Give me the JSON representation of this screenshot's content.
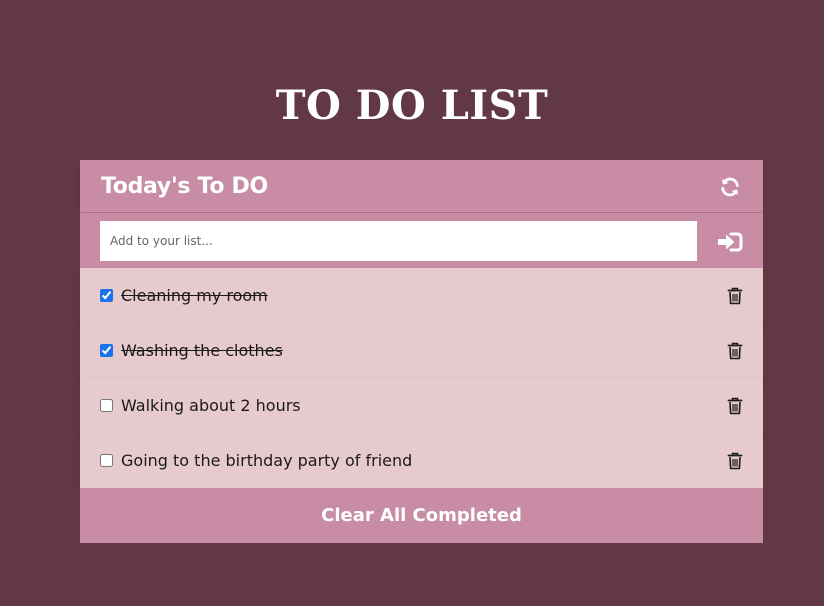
{
  "page": {
    "title": "TO DO LIST",
    "background_color": "#633845"
  },
  "card": {
    "title": "Today's To DO",
    "accent_color": "#c88ca5",
    "item_background": "#e7cacd",
    "refresh_icon": "refresh-icon"
  },
  "add_form": {
    "placeholder": "Add to your list...",
    "value": "",
    "submit_icon": "sign-in-icon"
  },
  "todos": [
    {
      "text": "Cleaning my room",
      "completed": true
    },
    {
      "text": "Washing the clothes",
      "completed": true
    },
    {
      "text": "Walking about 2 hours",
      "completed": false
    },
    {
      "text": "Going to the birthday party of friend",
      "completed": false
    }
  ],
  "footer": {
    "clear_label": "Clear All Completed"
  }
}
